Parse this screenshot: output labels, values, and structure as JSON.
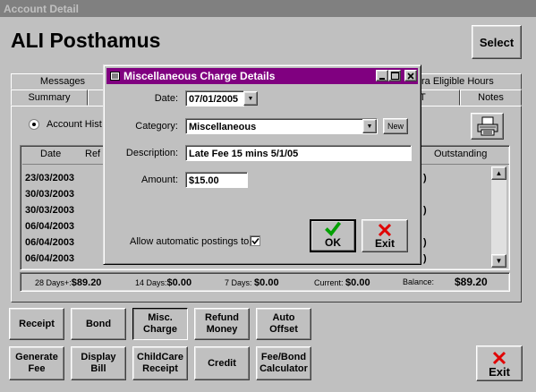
{
  "window": {
    "title": "Account Detail"
  },
  "patient": {
    "name": "ALI Posthamus"
  },
  "header": {
    "select_label": "Select"
  },
  "tabs": {
    "messages": "Messages",
    "extra_eligible": "ra Eligible Hours",
    "summary": "Summary",
    "t_partial": "T",
    "notes": "Notes"
  },
  "account_history": {
    "radio_label": "Account Hist"
  },
  "grid": {
    "headers": {
      "date": "Date",
      "ref": "Ref",
      "outstanding": "Outstanding"
    },
    "rows": [
      {
        "date": "23/03/2003",
        "right": ")"
      },
      {
        "date": "30/03/2003",
        "right": ""
      },
      {
        "date": "30/03/2003",
        "right": ")"
      },
      {
        "date": "06/04/2003",
        "right": ""
      },
      {
        "date": "06/04/2003",
        "right": ")"
      },
      {
        "date": "06/04/2003",
        "right": ")"
      }
    ]
  },
  "summary": {
    "d28_label": "28 Days+:",
    "d28_value": "$89.20",
    "d14_label": "14 Days:",
    "d14_value": "$0.00",
    "d7_label": "7 Days:",
    "d7_value": "$0.00",
    "current_label": "Current:",
    "current_value": "$0.00",
    "balance_label": "Balance:",
    "balance_value": "$89.20"
  },
  "actions": {
    "receipt": "Receipt",
    "bond": "Bond",
    "misc_charge": "Misc.\nCharge",
    "refund_money": "Refund\nMoney",
    "auto_offset": "Auto\nOffset",
    "generate_fee": "Generate\nFee",
    "display_bill": "Display\nBill",
    "childcare_receipt": "ChildCare\nReceipt",
    "credit": "Credit",
    "fee_bond_calc": "Fee/Bond\nCalculator",
    "exit": "Exit"
  },
  "dialog": {
    "title": "Miscellaneous Charge Details",
    "date_label": "Date:",
    "date_value": "07/01/2005",
    "category_label": "Category:",
    "category_value": "Miscellaneous",
    "new_label": "New",
    "description_label": "Description:",
    "description_value": "Late Fee 15 mins 5/1/05",
    "amount_label": "Amount:",
    "amount_value": "$15.00",
    "auto_post_label": "Allow automatic postings to",
    "auto_post_checked": true,
    "ok_label": "OK",
    "exit_label": "Exit"
  },
  "colors": {
    "dialog_title": "#800080",
    "window_face": "#c0c0c0",
    "ok_check": "#00a000",
    "exit_x": "#e00000"
  }
}
